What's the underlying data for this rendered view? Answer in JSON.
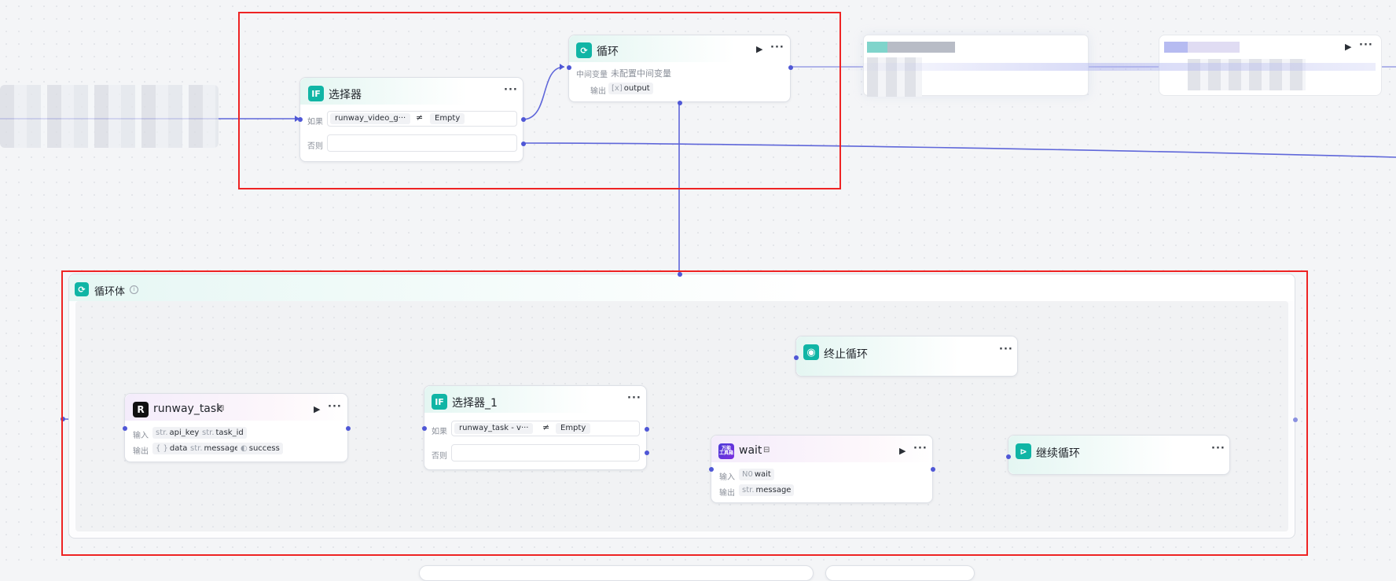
{
  "selector_top": {
    "title": "选择器",
    "icon": "IF",
    "if_label": "如果",
    "else_label": "否则",
    "cond_var": "runway_video_g···",
    "cond_op": "≠",
    "cond_val": "Empty"
  },
  "loop_node": {
    "title": "循环",
    "mid_label": "中间变量",
    "mid_value": "未配置中间变量",
    "out_label": "输出",
    "out_type": "[x]",
    "out_name": "output"
  },
  "loop_body": {
    "title": "循环体"
  },
  "runway_task": {
    "title": "runway_task",
    "in_label": "输入",
    "out_label": "输出",
    "inputs": [
      {
        "type": "str.",
        "name": "api_key"
      },
      {
        "type": "str.",
        "name": "task_id"
      }
    ],
    "outputs": [
      {
        "type": "{ }",
        "name": "data"
      },
      {
        "type": "str.",
        "name": "message"
      },
      {
        "type": "◐",
        "name": "success"
      }
    ]
  },
  "selector_1": {
    "title": "选择器_1",
    "icon": "IF",
    "if_label": "如果",
    "else_label": "否则",
    "cond_var": "runway_task - v···",
    "cond_op": "≠",
    "cond_val": "Empty"
  },
  "stop_loop": {
    "title": "终止循环"
  },
  "wait_node": {
    "title": "wait",
    "icon_text": "万能\n工具箱",
    "in_label": "输入",
    "out_label": "输出",
    "inputs": [
      {
        "type": "N0",
        "name": "wait"
      }
    ],
    "outputs": [
      {
        "type": "str.",
        "name": "message"
      }
    ]
  },
  "continue_loop": {
    "title": "继续循环"
  },
  "colors": {
    "accent": "#4f57d6",
    "teal": "#10b5a5",
    "highlight": "#ee2323"
  }
}
